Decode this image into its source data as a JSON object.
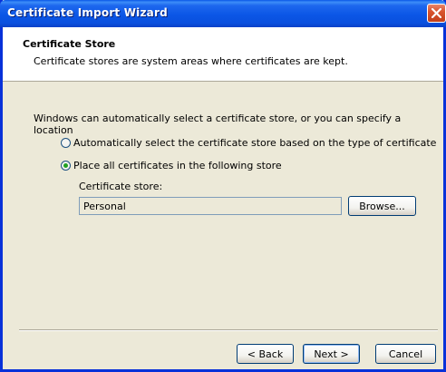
{
  "window": {
    "title": "Certificate Import Wizard"
  },
  "header": {
    "title": "Certificate Store",
    "subtitle": "Certificate stores are system areas where certificates are kept."
  },
  "body": {
    "intro": "Windows can automatically select a certificate store, or you can specify a location",
    "options": [
      {
        "label": "Automatically select the certificate store based on the type of certificate",
        "selected": false
      },
      {
        "label": "Place all certificates in the following store",
        "selected": true
      }
    ],
    "store_label": "Certificate store:",
    "store_value": "Personal",
    "browse_label": "Browse..."
  },
  "footer": {
    "back_label": "< Back",
    "next_label": "Next >",
    "cancel_label": "Cancel"
  },
  "colors": {
    "titlebar": "#0a50de",
    "dialog_bg": "#ece9d8",
    "close_button": "#d9552f"
  }
}
